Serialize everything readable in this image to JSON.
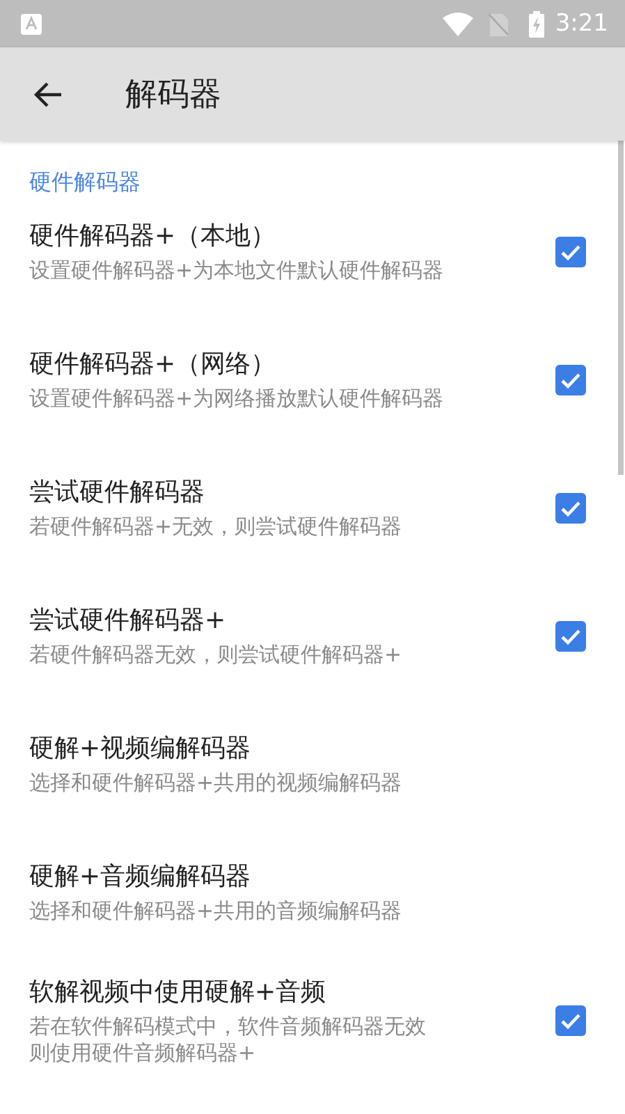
{
  "status_bar": {
    "time": "3:21"
  },
  "app_bar": {
    "title": "解码器"
  },
  "section": {
    "title": "硬件解码器"
  },
  "items": [
    {
      "kind": "checkbox",
      "title": "硬件解码器+（本地）",
      "summary": "设置硬件解码器+为本地文件默认硬件解码器",
      "checked": true
    },
    {
      "kind": "checkbox",
      "title": "硬件解码器+（网络）",
      "summary": "设置硬件解码器+为网络播放默认硬件解码器",
      "checked": true
    },
    {
      "kind": "checkbox",
      "title": "尝试硬件解码器",
      "summary": "若硬件解码器+无效，则尝试硬件解码器",
      "checked": true
    },
    {
      "kind": "checkbox",
      "title": "尝试硬件解码器+",
      "summary": "若硬件解码器无效，则尝试硬件解码器+",
      "checked": true
    },
    {
      "kind": "plain",
      "title": "硬解+视频编解码器",
      "summary": "选择和硬件解码器+共用的视频编解码器"
    },
    {
      "kind": "plain",
      "title": "硬解+音频编解码器",
      "summary": "选择和硬件解码器+共用的音频编解码器"
    },
    {
      "kind": "checkbox",
      "title": "软解视频中使用硬解+音频",
      "summary": "若在软件解码模式中，软件音频解码器无效则使用硬件音频解码器+",
      "checked": true
    }
  ]
}
